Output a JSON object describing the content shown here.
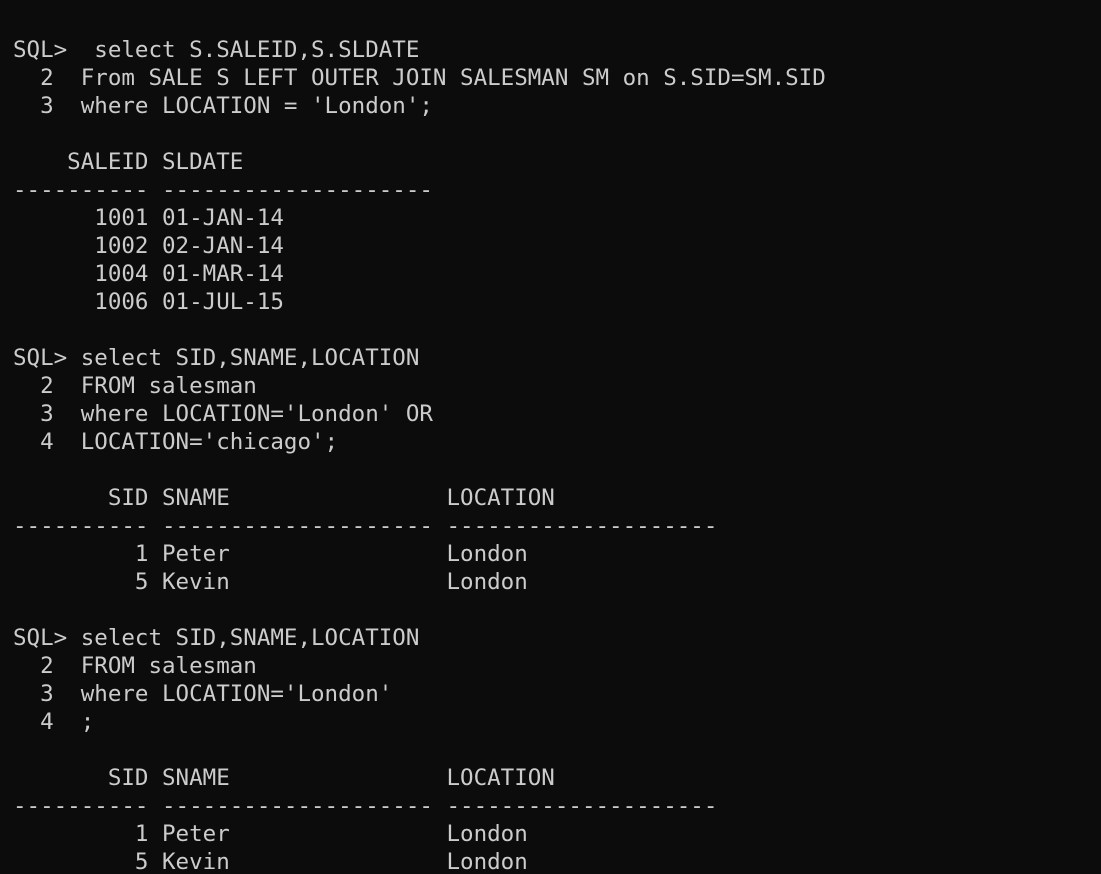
{
  "terminal": {
    "lines": [
      "SQL>  select S.SALEID,S.SLDATE",
      "  2  From SALE S LEFT OUTER JOIN SALESMAN SM on S.SID=SM.SID",
      "  3  where LOCATION = 'London';",
      "",
      "    SALEID SLDATE",
      "---------- --------------------",
      "      1001 01-JAN-14",
      "      1002 02-JAN-14",
      "      1004 01-MAR-14",
      "      1006 01-JUL-15",
      "",
      "SQL> select SID,SNAME,LOCATION",
      "  2  FROM salesman",
      "  3  where LOCATION='London' OR",
      "  4  LOCATION='chicago';",
      "",
      "       SID SNAME                LOCATION",
      "---------- -------------------- --------------------",
      "         1 Peter                London",
      "         5 Kevin                London",
      "",
      "SQL> select SID,SNAME,LOCATION",
      "  2  FROM salesman",
      "  3  where LOCATION='London'",
      "  4  ;",
      "",
      "       SID SNAME                LOCATION",
      "---------- -------------------- --------------------",
      "         1 Peter                London",
      "         5 Kevin                London"
    ]
  }
}
